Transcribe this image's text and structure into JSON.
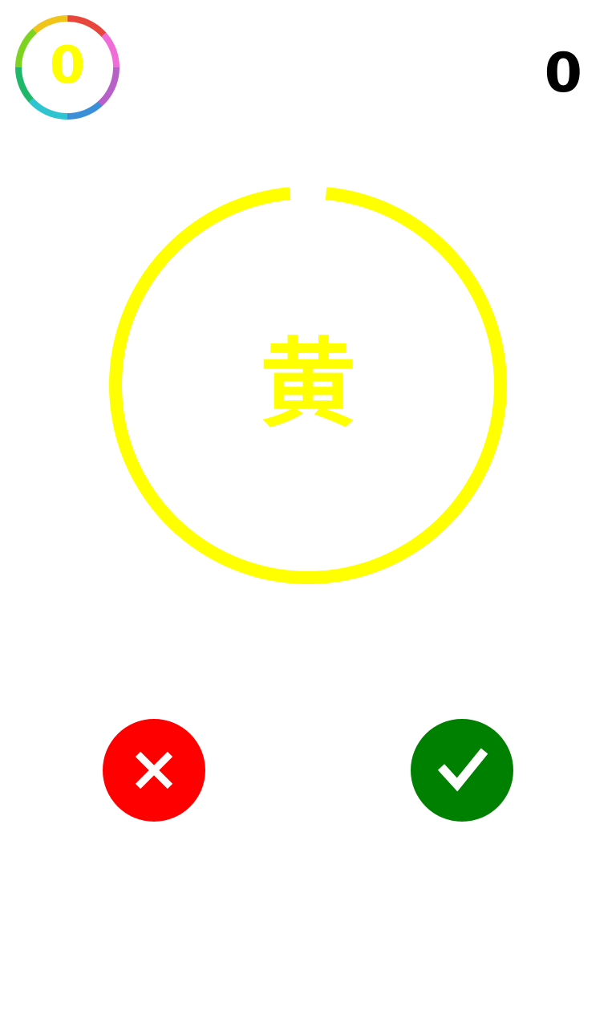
{
  "hud": {
    "badge_value": "0",
    "score": "0"
  },
  "game": {
    "word": "黄",
    "word_color": "#ffff00",
    "ring_color": "#ffff00",
    "timer_remaining_fraction": 0.97
  },
  "buttons": {
    "no_color": "#ff0000",
    "yes_color": "#008000",
    "no_icon": "close-icon",
    "yes_icon": "checkmark-icon"
  },
  "colors": {
    "badge_ring_gradient": [
      "#e8463a",
      "#f06cd8",
      "#b760c8",
      "#3a8fd8",
      "#2ec4d0",
      "#1fb86a",
      "#7ed321",
      "#f0c419",
      "#f0962e"
    ]
  }
}
